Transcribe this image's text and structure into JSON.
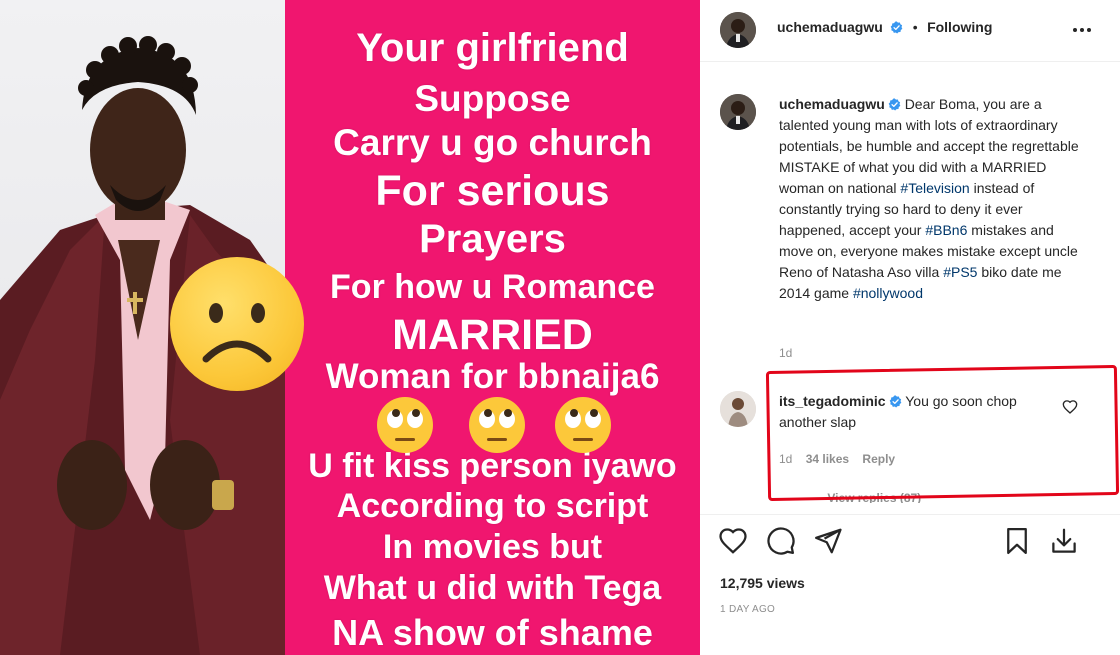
{
  "post": {
    "author": "uchemaduagwu",
    "following_label": "Following",
    "more_icon": "more-options-icon"
  },
  "meme": {
    "lines": [
      "Your girlfriend",
      "Suppose",
      "Carry u go church",
      "For serious",
      "Prayers",
      "For how u Romance",
      "MARRIED",
      "Woman for bbnaija6",
      "U fit kiss person iyawo",
      "According to script",
      "In movies but",
      "What u did with Tega",
      "NA show of shame"
    ],
    "background": "#f0166f"
  },
  "caption": {
    "author": "uchemaduagwu",
    "text_1": "Dear Boma, you are a talented young man with lots of extraordinary potentials, be humble and accept the regrettable MISTAKE of what you did with a MARRIED woman on national ",
    "tag_1": "#Television",
    "text_2": " instead of constantly trying so hard to deny it ever happened, accept your ",
    "tag_2": "#BBn6",
    "text_3": " mistakes and move on, everyone makes mistake except uncle Reno of Natasha Aso villa ",
    "tag_3": "#PS5",
    "text_4": " biko date me 2014 game ",
    "tag_4": "#nollywood",
    "age": "1d"
  },
  "comment": {
    "author": "its_tegadominic",
    "text": "You go soon chop another slap",
    "age": "1d",
    "likes": "34 likes",
    "reply_label": "Reply",
    "view_replies": "View replies (87)"
  },
  "footer": {
    "views": "12,795 views",
    "posted": "1 DAY AGO"
  },
  "colors": {
    "verified": "#3897f0",
    "hashtag": "#00376b",
    "annotation": "#e2051a"
  }
}
